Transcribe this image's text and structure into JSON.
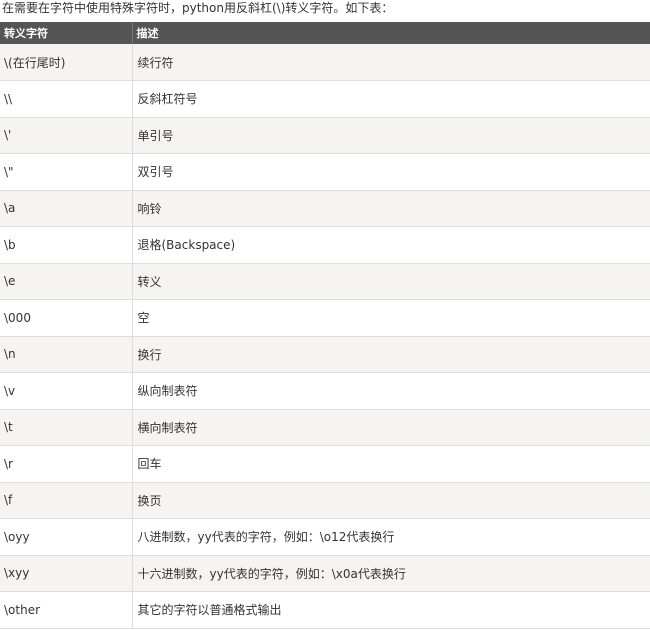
{
  "intro": "在需要在字符中使用特殊字符时，python用反斜杠(\\)转义字符。如下表：",
  "table": {
    "headers": [
      "转义字符",
      "描述"
    ],
    "rows": [
      [
        "\\(在行尾时)",
        "续行符"
      ],
      [
        "\\\\",
        "反斜杠符号"
      ],
      [
        "\\'",
        "单引号"
      ],
      [
        "\\\"",
        "双引号"
      ],
      [
        "\\a",
        "响铃"
      ],
      [
        "\\b",
        "退格(Backspace)"
      ],
      [
        "\\e",
        "转义"
      ],
      [
        "\\000",
        "空"
      ],
      [
        "\\n",
        "换行"
      ],
      [
        "\\v",
        "纵向制表符"
      ],
      [
        "\\t",
        "横向制表符"
      ],
      [
        "\\r",
        "回车"
      ],
      [
        "\\f",
        "换页"
      ],
      [
        "\\oyy",
        "八进制数，yy代表的字符，例如：\\o12代表换行"
      ],
      [
        "\\xyy",
        "十六进制数，yy代表的字符，例如：\\x0a代表换行"
      ],
      [
        "\\other",
        "其它的字符以普通格式输出"
      ]
    ]
  }
}
